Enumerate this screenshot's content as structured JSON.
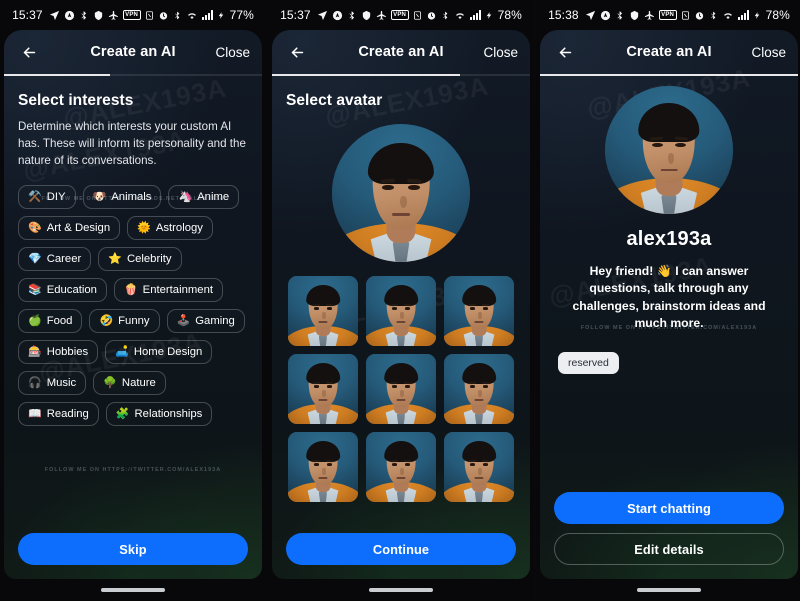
{
  "panels": [
    {
      "statusbar": {
        "time": "15:37",
        "battery": "77%",
        "vpn_label": "VPN"
      },
      "header": {
        "title": "Create an AI",
        "close_label": "Close",
        "back_icon": "arrow-left-icon"
      },
      "progress_percent": 41,
      "section": {
        "title": "Select interests",
        "body": "Determine which interests your custom AI has. These will inform its personality and the nature of its conversations."
      },
      "chips": [
        {
          "emoji": "⚒️",
          "label": "DIY",
          "icon": "diy-icon"
        },
        {
          "emoji": "🐶",
          "label": "Animals",
          "icon": "animals-icon"
        },
        {
          "emoji": "🦄",
          "label": "Anime",
          "icon": "anime-icon"
        },
        {
          "emoji": "🎨",
          "label": "Art & Design",
          "icon": "art-design-icon"
        },
        {
          "emoji": "🌞",
          "label": "Astrology",
          "icon": "astrology-icon"
        },
        {
          "emoji": "💎",
          "label": "Career",
          "icon": "career-icon"
        },
        {
          "emoji": "⭐",
          "label": "Celebrity",
          "icon": "celebrity-icon"
        },
        {
          "emoji": "📚",
          "label": "Education",
          "icon": "education-icon"
        },
        {
          "emoji": "🍿",
          "label": "Entertainment",
          "icon": "entertainment-icon"
        },
        {
          "emoji": "🍏",
          "label": "Food",
          "icon": "food-icon"
        },
        {
          "emoji": "🤣",
          "label": "Funny",
          "icon": "funny-icon"
        },
        {
          "emoji": "🕹️",
          "label": "Gaming",
          "icon": "gaming-icon"
        },
        {
          "emoji": "🎰",
          "label": "Hobbies",
          "icon": "hobbies-icon"
        },
        {
          "emoji": "🛋️",
          "label": "Home Design",
          "icon": "home-design-icon"
        },
        {
          "emoji": "🎧",
          "label": "Music",
          "icon": "music-icon"
        },
        {
          "emoji": "🌳",
          "label": "Nature",
          "icon": "nature-icon"
        },
        {
          "emoji": "📖",
          "label": "Reading",
          "icon": "reading-icon"
        },
        {
          "emoji": "🧩",
          "label": "Relationships",
          "icon": "relationships-icon"
        }
      ],
      "watermark_big": "@ALEX193A",
      "watermark_line_top": "FOLLOW ME ON HTTPS://THREADS.NET/@ALEX193A",
      "watermark_line_bottom": "FOLLOW ME ON HTTPS://TWITTER.COM/ALEX193A",
      "primary_button": "Skip"
    },
    {
      "statusbar": {
        "time": "15:37",
        "battery": "78%",
        "vpn_label": "VPN"
      },
      "header": {
        "title": "Create an AI",
        "close_label": "Close",
        "back_icon": "arrow-left-icon"
      },
      "progress_percent": 73,
      "section": {
        "title": "Select avatar",
        "body": ""
      },
      "avatar_count": 9,
      "watermark_big": "@ALEX193A",
      "primary_button": "Continue"
    },
    {
      "statusbar": {
        "time": "15:38",
        "battery": "78%",
        "vpn_label": "VPN"
      },
      "header": {
        "title": "Create an AI",
        "close_label": "Close",
        "back_icon": "arrow-left-icon"
      },
      "progress_percent": 100,
      "profile": {
        "name": "alex193a",
        "description": "Hey friend! 👋 I can answer questions, talk through any challenges, brainstorm ideas and much more.",
        "badge": "reserved"
      },
      "watermark_big": "@ALEX193A",
      "watermark_line_bottom": "FOLLOW ME ON HTTPS://TWITTER.COM/ALEX193A",
      "primary_button": "Start chatting",
      "secondary_button": "Edit details"
    }
  ],
  "colors": {
    "accent_blue": "#0d6efd",
    "badge_bg": "#eceef1",
    "progress_fill": "#e8e8ea"
  }
}
